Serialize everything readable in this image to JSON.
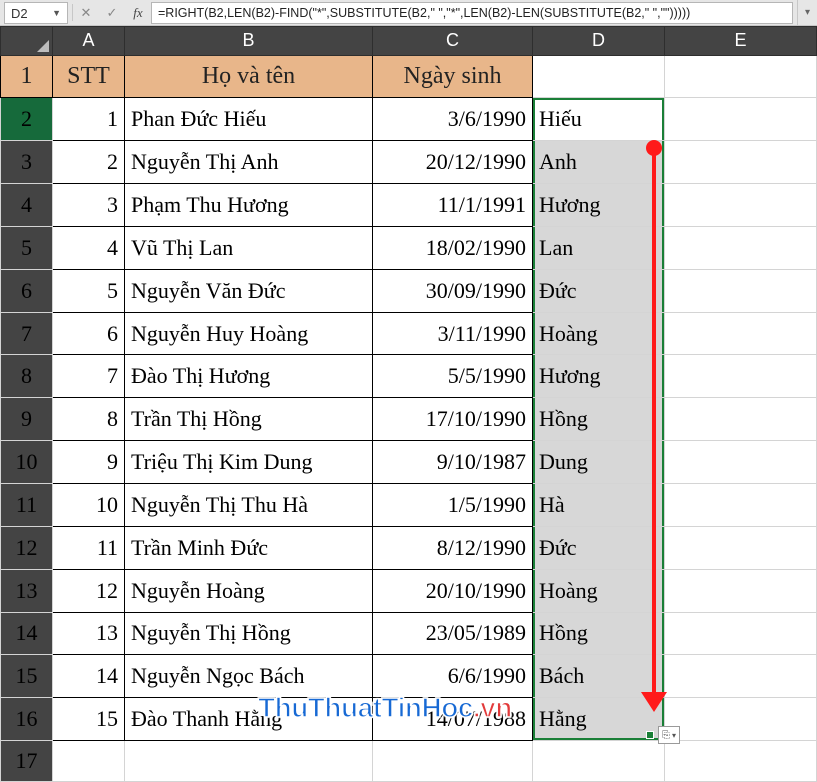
{
  "namebox": {
    "value": "D2"
  },
  "formula_bar": {
    "cancel_glyph": "✕",
    "enter_glyph": "✓",
    "fx_label": "fx",
    "formula": "=RIGHT(B2,LEN(B2)-FIND(\"*\",SUBSTITUTE(B2,\" \",\"*\",LEN(B2)-LEN(SUBSTITUTE(B2,\" \",\"\")))))"
  },
  "columns": [
    "A",
    "B",
    "C",
    "D",
    "E"
  ],
  "header_row": {
    "A": "STT",
    "B": "Họ và tên",
    "C": "Ngày sinh",
    "D": "",
    "E": ""
  },
  "rows": [
    {
      "n": 2,
      "A": "1",
      "B": "Phan Đức Hiếu",
      "C": "3/6/1990",
      "D": "Hiếu"
    },
    {
      "n": 3,
      "A": "2",
      "B": "Nguyễn Thị Anh",
      "C": "20/12/1990",
      "D": "Anh"
    },
    {
      "n": 4,
      "A": "3",
      "B": "Phạm Thu Hương",
      "C": "11/1/1991",
      "D": "Hương"
    },
    {
      "n": 5,
      "A": "4",
      "B": "Vũ Thị Lan",
      "C": "18/02/1990",
      "D": "Lan"
    },
    {
      "n": 6,
      "A": "5",
      "B": "Nguyễn Văn Đức",
      "C": "30/09/1990",
      "D": "Đức"
    },
    {
      "n": 7,
      "A": "6",
      "B": "Nguyễn Huy Hoàng",
      "C": "3/11/1990",
      "D": "Hoàng"
    },
    {
      "n": 8,
      "A": "7",
      "B": "Đào Thị Hương",
      "C": "5/5/1990",
      "D": "Hương"
    },
    {
      "n": 9,
      "A": "8",
      "B": "Trần Thị Hồng",
      "C": "17/10/1990",
      "D": "Hồng"
    },
    {
      "n": 10,
      "A": "9",
      "B": "Triệu Thị Kim Dung",
      "C": "9/10/1987",
      "D": "Dung"
    },
    {
      "n": 11,
      "A": "10",
      "B": "Nguyễn Thị Thu Hà",
      "C": "1/5/1990",
      "D": "Hà"
    },
    {
      "n": 12,
      "A": "11",
      "B": "Trần Minh Đức",
      "C": "8/12/1990",
      "D": "Đức"
    },
    {
      "n": 13,
      "A": "12",
      "B": "Nguyễn Hoàng",
      "C": "20/10/1990",
      "D": "Hoàng"
    },
    {
      "n": 14,
      "A": "13",
      "B": "Nguyễn Thị Hồng",
      "C": "23/05/1989",
      "D": "Hồng"
    },
    {
      "n": 15,
      "A": "14",
      "B": "Nguyễn Ngọc Bách",
      "C": "6/6/1990",
      "D": "Bách"
    },
    {
      "n": 16,
      "A": "15",
      "B": "Đào Thanh Hằng",
      "C": "14/07/1988",
      "D": "Hằng"
    }
  ],
  "blank_row": 17,
  "selection": {
    "range": "D2:D16",
    "active": "D2"
  },
  "autofill_options_icon": "⎘",
  "watermark": {
    "main": "ThuThuatTinHoc",
    "suffix": ".vn"
  }
}
